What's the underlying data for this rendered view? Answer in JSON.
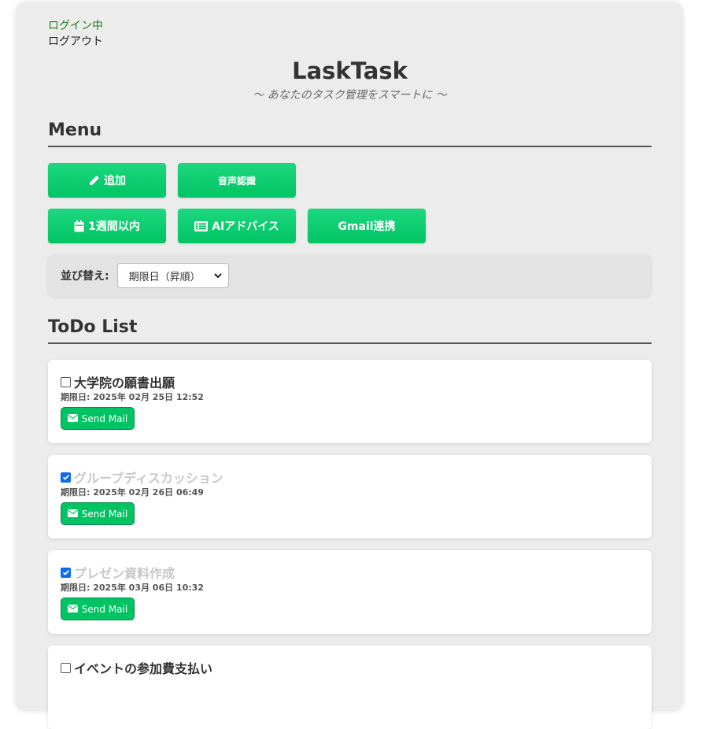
{
  "header": {
    "login_status": "ログイン中",
    "logout": "ログアウト",
    "title": "LaskTask",
    "subtitle": "〜 あなたのタスク管理をスマートに 〜"
  },
  "menu": {
    "title": "Menu",
    "buttons": {
      "add": "追加",
      "voice": "音声認識",
      "week": "1週間以内",
      "ai": "AIアドバイス",
      "gmail": "Gmail連携"
    }
  },
  "sort": {
    "label": "並び替え:",
    "selected": "期限日（昇順）"
  },
  "todo": {
    "title": "ToDo List",
    "mail_label": "Send Mail",
    "items": [
      {
        "name": "大学院の願書出願",
        "due": "期限日: 2025年 02月 25日 12:52",
        "checked": false
      },
      {
        "name": "グループディスカッション",
        "due": "期限日: 2025年 02月 26日 06:49",
        "checked": true
      },
      {
        "name": "プレゼン資料作成",
        "due": "期限日: 2025年 03月 06日 10:32",
        "checked": true
      },
      {
        "name": "イベントの参加費支払い",
        "due": "",
        "checked": false
      }
    ]
  },
  "colors": {
    "accent": "#00c464",
    "checkbox": "#0b6cf0",
    "done_text": "#c8c8c8"
  },
  "icons": {
    "add": "pencil-icon",
    "week": "calendar-icon",
    "ai": "list-alt-icon",
    "mail": "envelope-icon"
  }
}
